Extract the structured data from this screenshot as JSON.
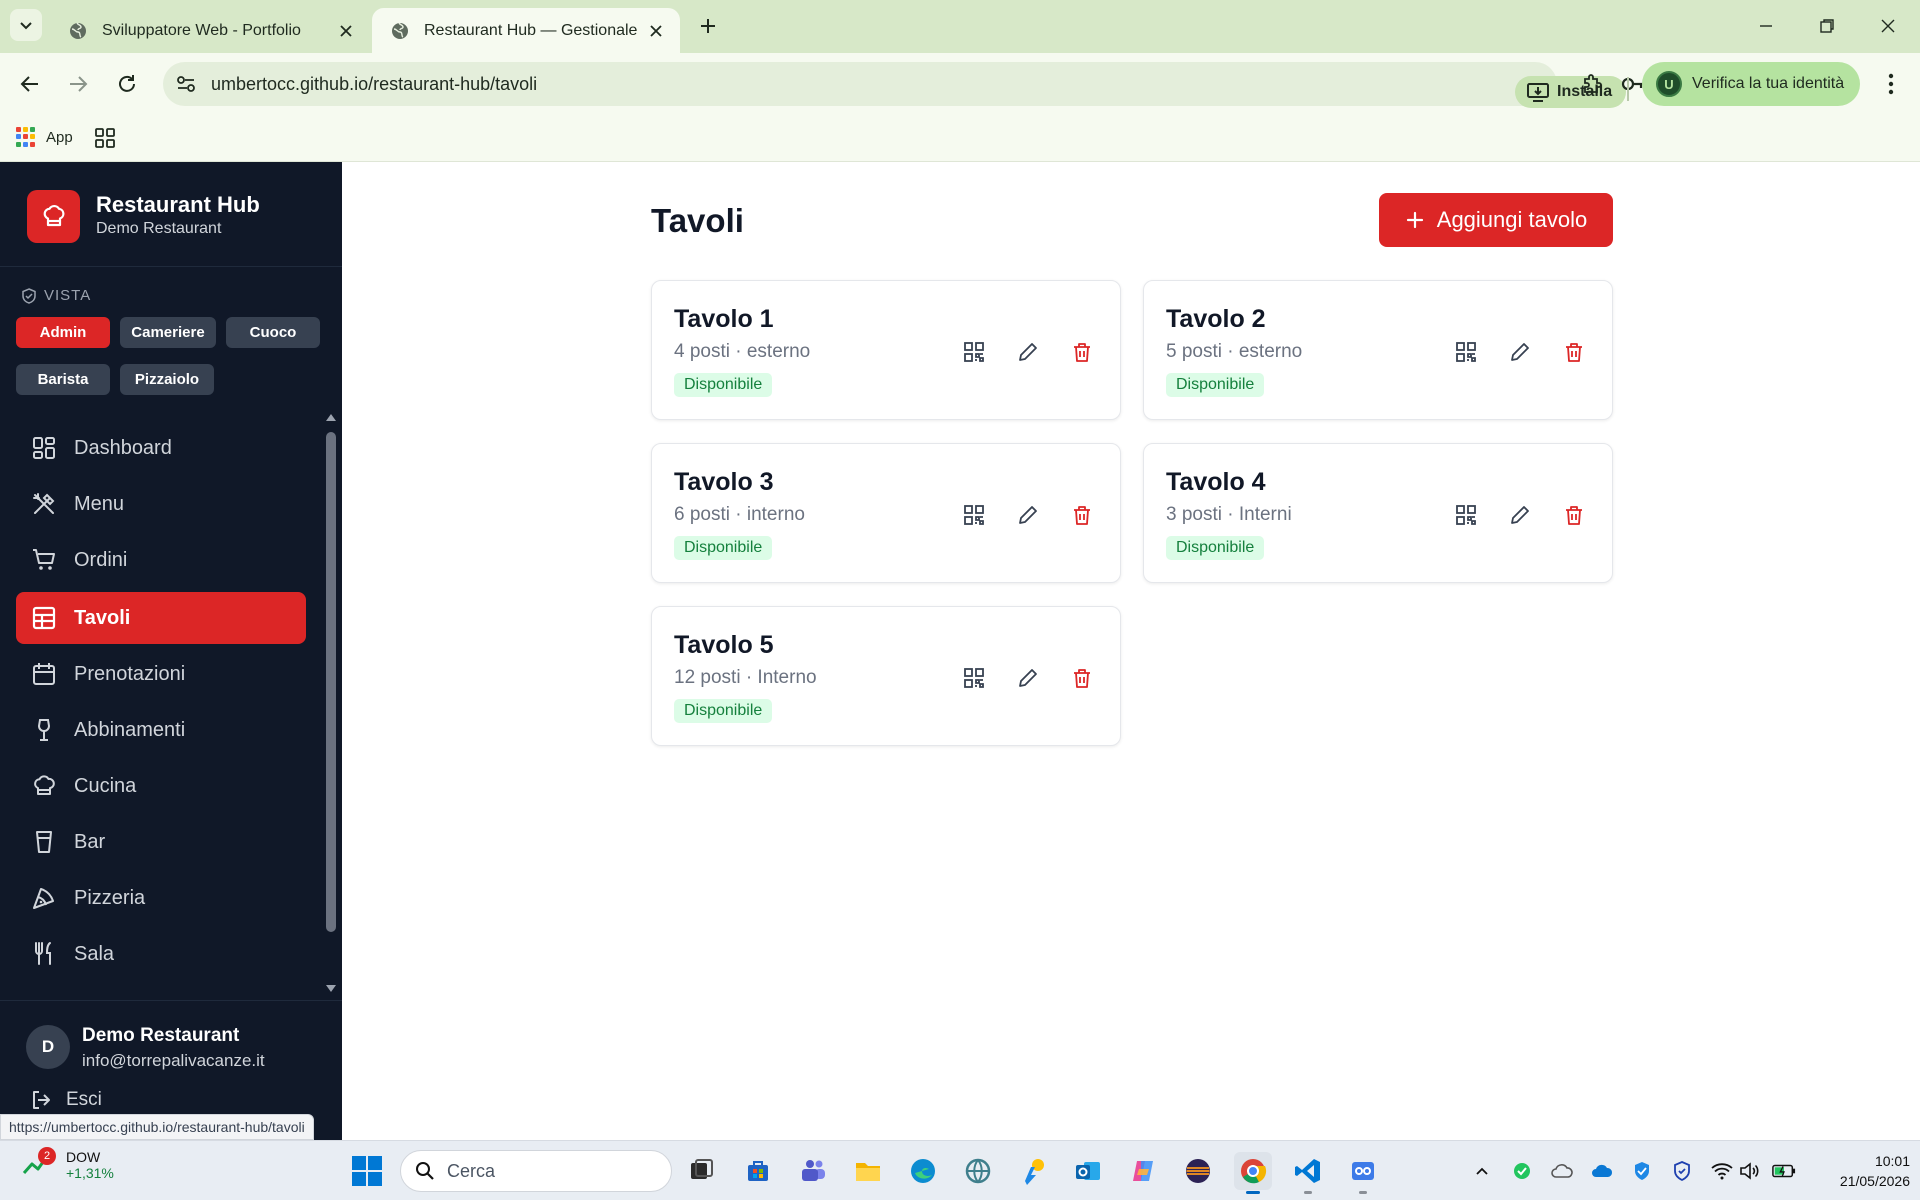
{
  "browser": {
    "tabs": [
      {
        "title": "Sviluppatore Web - Portfolio",
        "active": false
      },
      {
        "title": "Restaurant Hub — Gestionale",
        "active": true
      }
    ],
    "url": "umbertocc.github.io/restaurant-hub/tavoli",
    "install_label": "Installa",
    "identity_label": "Verifica la tua identità",
    "identity_avatar": "U",
    "bookmarks_apps_label": "App",
    "status_url": "https://umbertocc.github.io/restaurant-hub/tavoli"
  },
  "sidebar": {
    "brand_name": "Restaurant Hub",
    "brand_sub": "Demo Restaurant",
    "vista_label": "VISTA",
    "roles": [
      {
        "label": "Admin",
        "active": true
      },
      {
        "label": "Cameriere",
        "active": false
      },
      {
        "label": "Cuoco",
        "active": false
      },
      {
        "label": "Barista",
        "active": false
      },
      {
        "label": "Pizzaiolo",
        "active": false
      }
    ],
    "nav": [
      {
        "label": "Dashboard",
        "icon": "dashboard-icon",
        "active": false
      },
      {
        "label": "Menu",
        "icon": "utensils-crossed-icon",
        "active": false
      },
      {
        "label": "Ordini",
        "icon": "cart-icon",
        "active": false
      },
      {
        "label": "Tavoli",
        "icon": "table-icon",
        "active": true
      },
      {
        "label": "Prenotazioni",
        "icon": "calendar-icon",
        "active": false
      },
      {
        "label": "Abbinamenti",
        "icon": "wine-icon",
        "active": false
      },
      {
        "label": "Cucina",
        "icon": "chef-hat-icon",
        "active": false
      },
      {
        "label": "Bar",
        "icon": "glass-icon",
        "active": false
      },
      {
        "label": "Pizzeria",
        "icon": "pizza-icon",
        "active": false
      },
      {
        "label": "Sala",
        "icon": "fork-knife-icon",
        "active": false
      }
    ],
    "user": {
      "initial": "D",
      "name": "Demo Restaurant",
      "email": "info@torrepalivacanze.it"
    },
    "logout_label": "Esci"
  },
  "main": {
    "title": "Tavoli",
    "add_button": "Aggiungi tavolo",
    "tables": [
      {
        "name": "Tavolo 1",
        "meta": "4 posti · esterno",
        "status": "Disponibile"
      },
      {
        "name": "Tavolo 2",
        "meta": "5 posti · esterno",
        "status": "Disponibile"
      },
      {
        "name": "Tavolo 3",
        "meta": "6 posti · interno",
        "status": "Disponibile"
      },
      {
        "name": "Tavolo 4",
        "meta": "3 posti · Interni",
        "status": "Disponibile"
      },
      {
        "name": "Tavolo 5",
        "meta": "12 posti · Interno",
        "status": "Disponibile"
      }
    ]
  },
  "colors": {
    "accent": "#dc2626",
    "sidebar_bg": "#101828",
    "badge_bg": "#dcfce7",
    "badge_text": "#15803d"
  },
  "taskbar": {
    "widget_badge": "2",
    "widget_title": "DOW",
    "widget_value": "+1,31%",
    "search_placeholder": "Cerca",
    "time": "10:01",
    "date": "21/05/2026"
  }
}
